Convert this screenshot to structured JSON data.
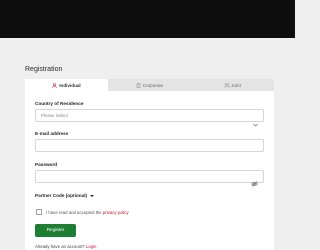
{
  "page": {
    "title": "Registration"
  },
  "tabs": [
    {
      "label": "Individual",
      "icon": "user-icon",
      "active": true
    },
    {
      "label": "Corporate",
      "icon": "building-icon",
      "active": false
    },
    {
      "label": "Joint",
      "icon": "users-icon",
      "active": false
    }
  ],
  "form": {
    "country_label": "Country of Residence",
    "country_placeholder": "Please Select",
    "email_label": "E-mail address",
    "email_value": "",
    "password_label": "Password",
    "password_value": "",
    "partner_label": "Partner Code (optional)",
    "agree_text": "I have read and accepted the",
    "privacy_link": "privacy policy",
    "register_label": "Register",
    "have_account_text": "Already have an account?",
    "login_link": "Login"
  },
  "colors": {
    "accent_red": "#c8102e",
    "register_green": "#1e7e34",
    "topbar": "#0d0d0d",
    "background": "#efefef"
  }
}
